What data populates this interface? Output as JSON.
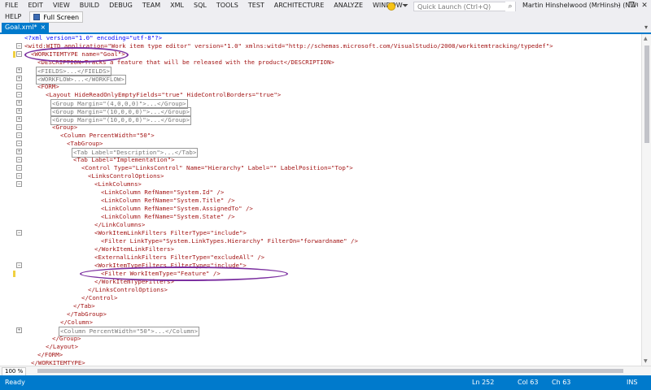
{
  "menu": {
    "items": [
      "FILE",
      "EDIT",
      "VIEW",
      "BUILD",
      "DEBUG",
      "TEAM",
      "XML",
      "SQL",
      "TOOLS",
      "TEST",
      "ARCHITECTURE",
      "ANALYZE",
      "WINDOW"
    ],
    "help": "HELP",
    "full_screen": "Full Screen",
    "quick_launch_placeholder": "Quick Launch (Ctrl+Q)",
    "user": "Martin Hinshelwood (MrHinsh) (NWC)",
    "icons": {
      "feedback": "smiley-icon",
      "filter": "filter-icon",
      "search": "search-icon"
    }
  },
  "tab": {
    "title": "Goal.xml*",
    "close": "×",
    "dropdown": "▾"
  },
  "window": {
    "minimize": "–",
    "restore": "❐",
    "close": "✕"
  },
  "code": {
    "l1": "<?xml version=\"1.0\" encoding=\"utf-8\"?>",
    "l2": "<witd:WITD application=\"Work item type editor\" version=\"1.0\" xmlns:witd=\"http://schemas.microsoft.com/VisualStudio/2008/workitemtracking/typedef\">",
    "l3": "<WORKITEMTYPE name=\"Goal\">",
    "l4": "<DESCRIPTION>Tracks a feature that will be released with the product</DESCRIPTION>",
    "l5": "<FIELDS>...</FIELDS>",
    "l6": "<WORKFLOW>...</WORKFLOW>",
    "l7": "<FORM>",
    "l8": "<Layout HideReadOnlyEmptyFields=\"true\" HideControlBorders=\"true\">",
    "l9": "<Group Margin=\"(4,0,0,0)\">...</Group>",
    "l10": "<Group Margin=\"(10,0,0,0)\">...</Group>",
    "l11": "<Group Margin=\"(10,0,0,0)\">...</Group>",
    "l12": "<Group>",
    "l13": "<Column PercentWidth=\"50\">",
    "l14": "<TabGroup>",
    "l15": "<Tab Label=\"Description\">...</Tab>",
    "l16": "<Tab Label=\"Implementation\">",
    "l17": "<Control Type=\"LinksControl\" Name=\"Hierarchy\" Label=\"\" LabelPosition=\"Top\">",
    "l18": "<LinksControlOptions>",
    "l19": "<LinkColumns>",
    "l20": "<LinkColumn RefName=\"System.Id\" />",
    "l21": "<LinkColumn RefName=\"System.Title\" />",
    "l22": "<LinkColumn RefName=\"System.AssignedTo\" />",
    "l23": "<LinkColumn RefName=\"System.State\" />",
    "l24": "</LinkColumns>",
    "l25": "<WorkItemLinkFilters FilterType=\"include\">",
    "l26": "<Filter LinkType=\"System.LinkTypes.Hierarchy\" FilterOn=\"forwardname\" />",
    "l27": "</WorkItemLinkFilters>",
    "l28": "<ExternalLinkFilters FilterType=\"excludeAll\" />",
    "l29": "<WorkItemTypeFilters FilterType=\"include\">",
    "l30": "<Filter WorkItemType=\"Feature\" />",
    "l31": "</WorkItemTypeFilters>",
    "l32": "</LinksControlOptions>",
    "l33": "</Control>",
    "l34": "</Tab>",
    "l35": "</TabGroup>",
    "l36": "</Column>",
    "l37": "<Column PercentWidth=\"50\">...</Column>",
    "l38": "</Group>",
    "l39": "</Layout>",
    "l40": "</FORM>",
    "l41": "</WORKITEMTYPE>"
  },
  "editor": {
    "zoom": "100 %"
  },
  "status": {
    "ready": "Ready",
    "line": "Ln 252",
    "col": "Col 63",
    "ch": "Ch 63",
    "mode": "INS"
  },
  "colors": {
    "accent": "#007acc",
    "annotation": "#7b2fa0",
    "tag": "#a31515",
    "attr": "#ff0000",
    "value": "#0000ff"
  }
}
